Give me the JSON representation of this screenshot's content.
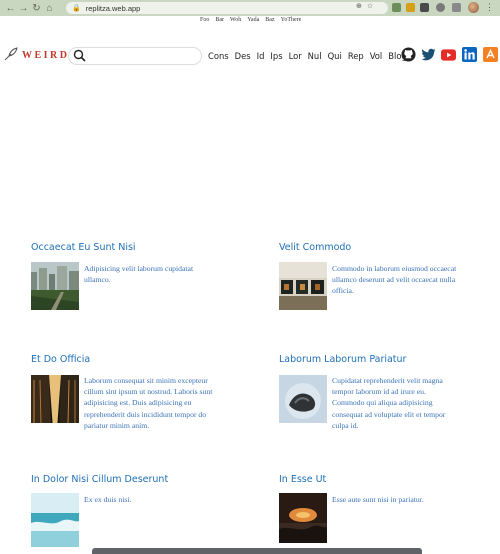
{
  "browser": {
    "url": "replitza.web.app",
    "nav_icons": [
      "arrow-left-icon",
      "arrow-right-icon",
      "reload-icon",
      "home-icon"
    ]
  },
  "top_links": [
    "Foo",
    "Bar",
    "Woh",
    "Yada",
    "Baz",
    "YoThere"
  ],
  "header": {
    "logo_text": "WEIRD",
    "search_placeholder": "",
    "menu": [
      "Cons",
      "Des",
      "Id",
      "Ips",
      "Lor",
      "Nul",
      "Qui",
      "Rep",
      "Vol",
      "Blog"
    ],
    "social_icons": [
      "github-icon",
      "twitter-icon",
      "youtube-icon",
      "linkedin-icon",
      "stackoverflow-icon"
    ]
  },
  "cards": [
    {
      "title": "Occaecat Eu Sunt Nisi",
      "lines": [
        "Adipisicing velit laborum cupidatat",
        "ullamco."
      ]
    },
    {
      "title": "Velit Commodo",
      "lines": [
        "Commodo in laborum eiusmod occaecat",
        "ullamco deserunt ad velit occaecat nulla",
        "officia."
      ]
    },
    {
      "title": "Et Do Officia",
      "lines": [
        "Laborum consequat sit minim excepteur",
        "cillum sint ipsum ut nostrud. Laboris sunt",
        "adipisicing est. Duis adipisicing eu",
        "reprehenderit duis incididunt tempor do",
        "pariatur minim anim."
      ]
    },
    {
      "title": "Laborum Laborum Pariatur",
      "lines": [
        "Cupidatat reprehenderit velit magna",
        "tempor laborum id ad irure eu.",
        "Commodo qui aliqua adipisicing",
        "consequat ad voluptate elit et tempor",
        "culpa id."
      ]
    },
    {
      "title": "In Dolor Nisi Cillum Deserunt",
      "lines": [
        "Ex ex duis nisi."
      ]
    },
    {
      "title": "In Esse Ut",
      "lines": [
        "Esse aute sunt nisi in pariatur."
      ]
    }
  ],
  "colors": {
    "chrome": "#c9d6c0",
    "logo": "#c0392b",
    "card_title": "#1f6fb5",
    "card_text": "#3a73b8"
  }
}
